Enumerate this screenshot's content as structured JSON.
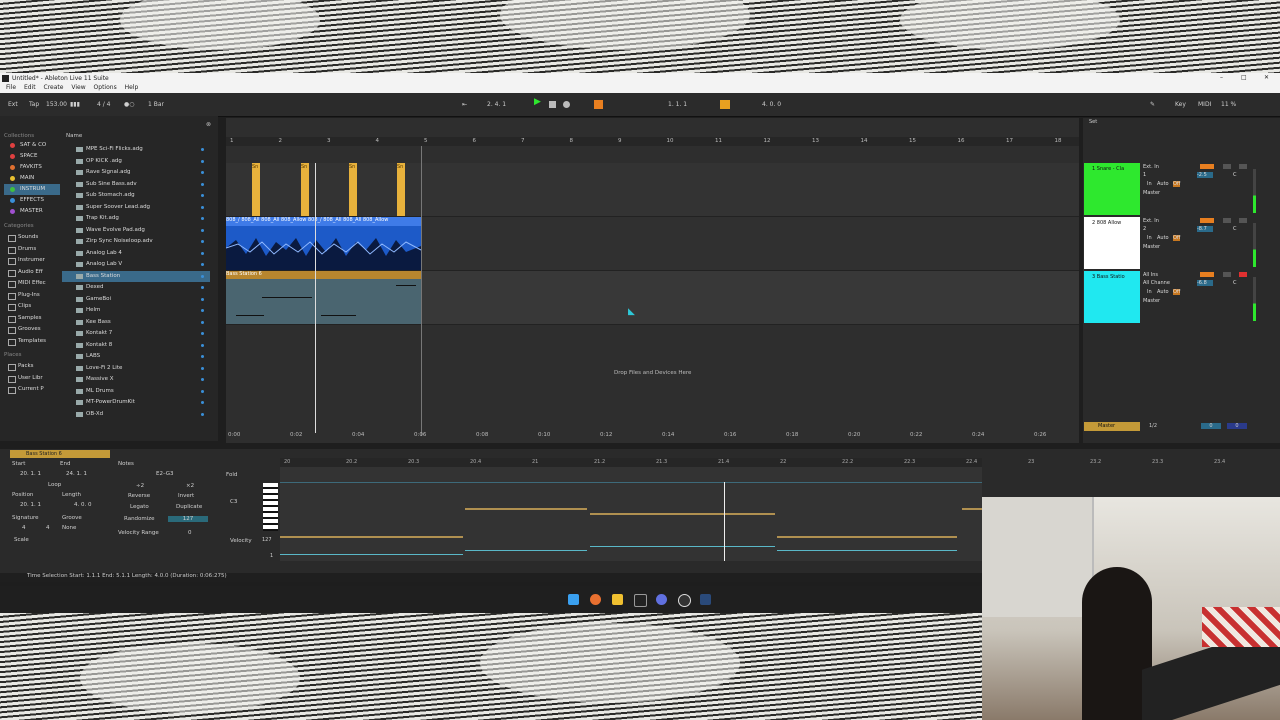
{
  "window": {
    "title": "Untitled* - Ableton Live 11 Suite",
    "menus": [
      "File",
      "Edit",
      "Create",
      "View",
      "Options",
      "Help"
    ]
  },
  "control_bar": {
    "ext": "Ext",
    "tap": "Tap",
    "tempo": "153.00",
    "time_sig": "4 / 4",
    "quantize": "1 Bar",
    "position": "2.  4.  1",
    "loop_start": "1.  1.  1",
    "loop_length": "4.  0.  0",
    "key": "Key",
    "midi": "MIDI",
    "cpu": "11 %"
  },
  "browser": {
    "collections_header": "Collections",
    "collections": [
      {
        "label": "SAT & CO",
        "color": "#e04040"
      },
      {
        "label": "SPACE",
        "color": "#e04040"
      },
      {
        "label": "FAVKITS",
        "color": "#e07030"
      },
      {
        "label": "MAIN",
        "color": "#e8c030"
      },
      {
        "label": "INSTRUM",
        "color": "#40c040"
      },
      {
        "label": "EFFECTS",
        "color": "#3a8fd8"
      },
      {
        "label": "MASTER",
        "color": "#a050d0"
      }
    ],
    "categories_header": "Categories",
    "categories": [
      "Sounds",
      "Drums",
      "Instrumer",
      "Audio Eff",
      "MIDI Effec",
      "Plug-Ins",
      "Clips",
      "Samples",
      "Grooves",
      "Templates"
    ],
    "places_header": "Places",
    "places": [
      "Packs",
      "User Libr",
      "Current P"
    ],
    "name_header": "Name",
    "files": [
      "MPE Sci-Fi Flicks.adg",
      "OP KICK .adg",
      "Rave Signal.adg",
      "Sub Sine Bass.adv",
      "Sub Stomach.adg",
      "Super Soover Lead.adg",
      "Trap Kit.adg",
      "Wave Evolve Pad.adg",
      "Zirp Sync Noiseloop.adv",
      "Analog Lab 4",
      "Analog Lab V",
      "Bass Station",
      "Dexed",
      "GameBoi",
      "Helm",
      "Kee Bass",
      "Kontakt 7",
      "Kontakt 8",
      "LABS",
      "Love-Fi 2 Lite",
      "Massive X",
      "ML Drums",
      "MT-PowerDrumKit",
      "OB-Xd"
    ]
  },
  "arrangement": {
    "ruler": [
      "1",
      "2",
      "3",
      "4",
      "5",
      "6",
      "7",
      "8",
      "9",
      "10",
      "11",
      "12",
      "13",
      "14",
      "15",
      "16",
      "17",
      "18"
    ],
    "clip_names": {
      "snare": "Sn",
      "bass808": "808_/ 808_All 808_All 808_Allow 808_/ 808_All 808_All 808_Allow",
      "bass_station": "Bass Station 6"
    },
    "drop_text": "Drop Files and Devices Here",
    "time_labels": [
      "0:00",
      "0:02",
      "0:04",
      "0:06",
      "0:08",
      "0:10",
      "0:12",
      "0:14",
      "0:16",
      "0:18",
      "0:20",
      "0:22",
      "0:24",
      "0:26"
    ],
    "zoom": "1/2"
  },
  "mixer": {
    "set_label": "Set",
    "tracks": [
      {
        "name": "1 Snare - Cla",
        "color": "#2ee82e",
        "input": "Ext. In",
        "channel": "1",
        "vol": "-2.5",
        "pan": "C",
        "out": "Master"
      },
      {
        "name": "2 808 Allow",
        "color": "#ffffff",
        "input": "Ext. In",
        "channel": "2",
        "vol": "-8.7",
        "pan": "C",
        "out": "Master"
      },
      {
        "name": "3 Bass Statio",
        "color": "#20e8f0",
        "input": "All Ins",
        "channel": "All Channe",
        "vol": "-6.8",
        "pan": "C",
        "out": "Master"
      }
    ],
    "monitor": {
      "in": "In",
      "auto": "Auto",
      "off": "Off"
    },
    "master": {
      "name": "Master",
      "zoom": "1/2",
      "vol": "0",
      "pan": "0"
    }
  },
  "detail": {
    "clip_name": "Bass Station 6",
    "start_label": "Start",
    "end_label": "End",
    "start": "20.  1.  1",
    "end": "24.  1.  1",
    "loop_label": "Loop",
    "position_label": "Position",
    "length_label": "Length",
    "position": "20.  1.  1",
    "length": "4.  0.  0",
    "signature_label": "Signature",
    "groove_label": "Groove",
    "sig_num": "4",
    "sig_den": "4",
    "groove": "None",
    "scale_label": "Scale",
    "notes_header": "Notes",
    "note_range": "E2–G3",
    "div2": "÷2",
    "mul2": "×2",
    "reverse": "Reverse",
    "invert": "Invert",
    "legato": "Legato",
    "duplicate": "Duplicate",
    "randomize": "Randomize",
    "rand_val": "127",
    "velocity_range_label": "Velocity Range",
    "velocity_range": "0",
    "fold": "Fold",
    "c3": "C3",
    "velocity_label": "Velocity",
    "vel_max": "127",
    "vel_min": "1",
    "ruler": [
      "20",
      "20.2",
      "20.3",
      "20.4",
      "21",
      "21.2",
      "21.3",
      "21.4",
      "22",
      "22.2",
      "22.3",
      "22.4",
      "23",
      "23.2",
      "23.3",
      "23.4"
    ]
  },
  "status": {
    "text": "Time Selection   Start: 1.1.1   End: 5.1.1   Length: 4.0.0  (Duration: 0:06:275)"
  }
}
